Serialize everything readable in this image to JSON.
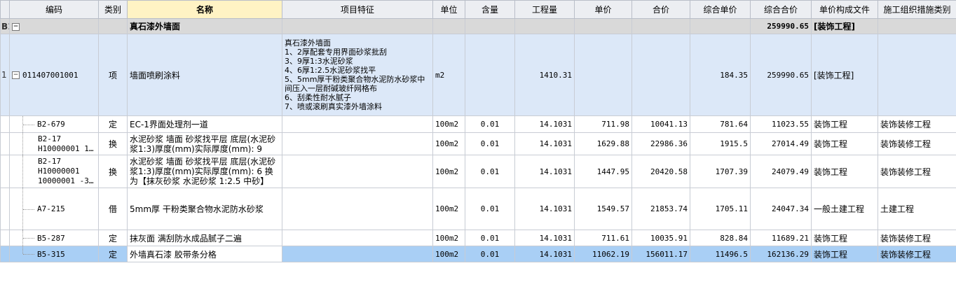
{
  "columns": {
    "code": "编码",
    "category": "类别",
    "name": "名称",
    "feature": "项目特征",
    "unit": "单位",
    "content": "含量",
    "quantity": "工程量",
    "unit_price": "单价",
    "total_price": "合价",
    "comp_unit_price": "综合单价",
    "comp_total_price": "综合合价",
    "price_file": "单价构成文件",
    "measure_type": "施工组织措施类别"
  },
  "section": {
    "row_no": "B1",
    "toggle": "−",
    "name": "真石漆外墙面",
    "comp_total_price": "259990.65",
    "price_file": "[装饰工程]"
  },
  "item": {
    "row_no": "1",
    "toggle": "−",
    "code": "011407001001",
    "category": "项",
    "name": "墙面喷刷涂料",
    "feature_lines": [
      "真石漆外墙面",
      "1、2厚配套专用界面砂浆批刮",
      "3、9厚1:3水泥砂浆",
      "4、6厚1:2.5水泥砂浆找平",
      "5、5mm厚干粉类聚合物水泥防水砂浆中间压入一层耐碱玻纤网格布",
      "6、刮柔性耐水腻子",
      "7、喷或滚刷真实漆外墙涂料"
    ],
    "unit": "m2",
    "quantity": "1410.31",
    "comp_unit_price": "184.35",
    "comp_total_price": "259990.65",
    "price_file": "[装饰工程]"
  },
  "sub_rows": [
    {
      "code": "B2-679",
      "category": "定",
      "name": "EC-1界面处理剂一道",
      "unit": "100m2",
      "content": "0.01",
      "quantity": "14.1031",
      "unit_price": "711.98",
      "total_price": "10041.13",
      "comp_unit_price": "781.64",
      "comp_total_price": "11023.55",
      "price_file": "装饰工程",
      "measure_type": "装饰装修工程"
    },
    {
      "code": "B2-17 H10000001 1…",
      "category": "换",
      "name": "水泥砂浆 墙面 砂浆找平层  底层(水泥砂浆1:3)厚度(mm)实际厚度(mm): 9",
      "unit": "100m2",
      "content": "0.01",
      "quantity": "14.1031",
      "unit_price": "1629.88",
      "total_price": "22986.36",
      "comp_unit_price": "1915.5",
      "comp_total_price": "27014.49",
      "price_file": "装饰工程",
      "measure_type": "装饰装修工程"
    },
    {
      "code": "B2-17 H10000001 10000001 -3…",
      "category": "换",
      "name": "水泥砂浆 墙面 砂浆找平层  底层(水泥砂浆1:3)厚度(mm)实际厚度(mm): 6  换为【抹灰砂浆 水泥砂浆 1:2.5 中砂】",
      "unit": "100m2",
      "content": "0.01",
      "quantity": "14.1031",
      "unit_price": "1447.95",
      "total_price": "20420.58",
      "comp_unit_price": "1707.39",
      "comp_total_price": "24079.49",
      "price_file": "装饰工程",
      "measure_type": "装饰装修工程"
    },
    {
      "code": "A7-215",
      "category": "借",
      "name": "5mm厚 干粉类聚合物水泥防水砂浆",
      "unit": "100m2",
      "content": "0.01",
      "quantity": "14.1031",
      "unit_price": "1549.57",
      "total_price": "21853.74",
      "comp_unit_price": "1705.11",
      "comp_total_price": "24047.34",
      "price_file": "一般土建工程",
      "measure_type": "土建工程"
    },
    {
      "code": "B5-287",
      "category": "定",
      "name": "抹灰面 满刮防水成品腻子二遍",
      "unit": "100m2",
      "content": "0.01",
      "quantity": "14.1031",
      "unit_price": "711.61",
      "total_price": "10035.91",
      "comp_unit_price": "828.84",
      "comp_total_price": "11689.21",
      "price_file": "装饰工程",
      "measure_type": "装饰装修工程"
    },
    {
      "code": "B5-315",
      "category": "定",
      "name": "外墙真石漆 胶带条分格",
      "unit": "100m2",
      "content": "0.01",
      "quantity": "14.1031",
      "unit_price": "11062.19",
      "total_price": "156011.17",
      "comp_unit_price": "11496.5",
      "comp_total_price": "162136.29",
      "price_file": "装饰工程",
      "measure_type": "装饰装修工程"
    }
  ]
}
